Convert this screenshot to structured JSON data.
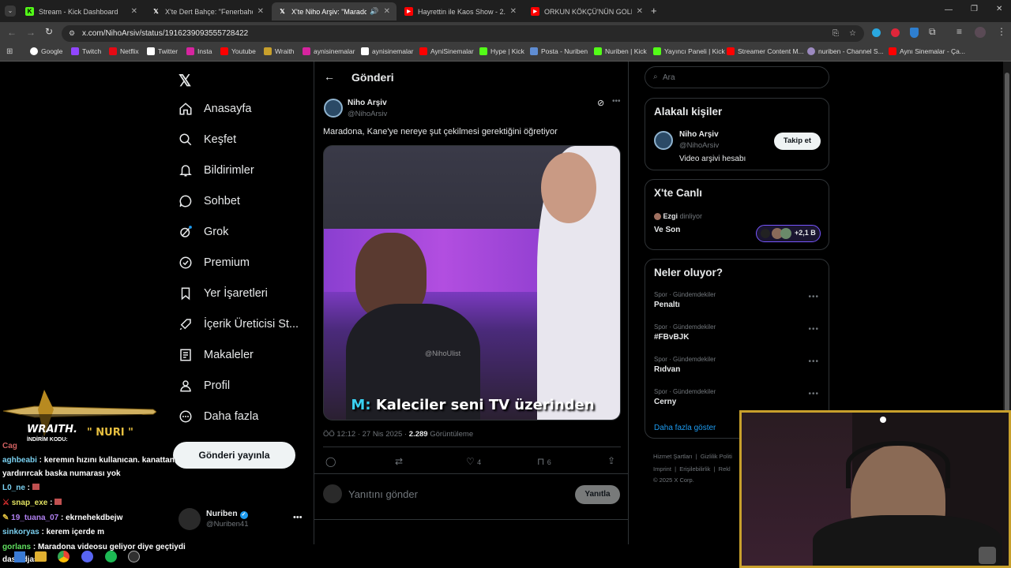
{
  "tabs": [
    {
      "label": "Stream - Kick Dashboard",
      "color": "#53fc18"
    },
    {
      "label": "X'te Dert Bahçe: \"Fenerbahçe'n",
      "color": "#ffffff"
    },
    {
      "label": "X'te Niho Arşiv: \"Maradona",
      "color": "#ffffff"
    },
    {
      "label": "Hayrettin ile Kaos Show - 2.Se",
      "color": "#ff0000"
    },
    {
      "label": "ORKUN KÖKÇÜ'NÜN GOLLERİ",
      "color": "#ff0000"
    }
  ],
  "url": "x.com/NihoArsiv/status/1916239093555728422",
  "bookmarks": [
    "Google",
    "Twitch",
    "Netflix",
    "Twitter",
    "Insta",
    "Youtube",
    "Wraith",
    "aynisinemalar",
    "aynisinemalar",
    "AyniSinemalar",
    "Hype | Kick",
    "Posta - Nuriben",
    "Nuriben | Kick",
    "Yayıncı Paneli | Kick",
    "Streamer Content M...",
    "nuriben - Channel S...",
    "Aynı Sinemalar - Ça..."
  ],
  "nav": {
    "items": [
      "Anasayfa",
      "Keşfet",
      "Bildirimler",
      "Sohbet",
      "Grok",
      "Premium",
      "Yer İşaretleri",
      "İçerik Üreticisi St...",
      "Makaleler",
      "Profil",
      "Daha fazla"
    ],
    "post_button": "Gönderi yayınla",
    "account_name": "Nuriben",
    "account_handle": "@Nuriben41"
  },
  "post": {
    "header": "Gönderi",
    "author": "Niho Arşiv",
    "handle": "@NihoArsiv",
    "text": "Maradona, Kane'ye nereye şut çekilmesi gerektiğini öğretiyor",
    "video_watermark": "@NihoUlist",
    "video_caption_prefix": "M:",
    "video_caption": "Kaleciler seni TV üzerinden",
    "time": "ÖÖ 12:12 · 27 Nis 2025 · ",
    "views": "2.289",
    "views_label": " Görüntüleme",
    "likes": "4",
    "bookmarks": "6",
    "reply_placeholder": "Yanıtını gönder",
    "reply_button": "Yanıtla"
  },
  "sidebar": {
    "search_placeholder": "Ara",
    "people_title": "Alakalı kişiler",
    "person_name": "Niho Arşiv",
    "person_handle": "@NihoArsiv",
    "person_bio": "Video arşivi hesabı",
    "follow_button": "Takip et",
    "live_title": "X'te Canlı",
    "live_host": "Ezgi",
    "live_status": " dinliyor",
    "live_space": "Ve Son",
    "live_count": "+2,1 B",
    "trends_title": "Neler oluyor?",
    "trends": [
      {
        "category": "Spor · Gündemdekiler",
        "name": "Penaltı"
      },
      {
        "category": "Spor · Gündemdekiler",
        "name": "#FBvBJK"
      },
      {
        "category": "Spor · Gündemdekiler",
        "name": "Rıdvan"
      },
      {
        "category": "Spor · Gündemdekiler",
        "name": "Cerny"
      }
    ],
    "show_more": "Daha fazla göster",
    "footer_1": "Hizmet Şartları  |  Gizlilik Politi",
    "footer_2": "Imprint  |  Erişilebilirlik  |  Rekl",
    "footer_3": "© 2025 X Corp."
  },
  "overlay": {
    "wraith_title": "WRAITH.",
    "wraith_code_label": "İNDİRİM KODU:",
    "wraith_code": "\" NURI \"",
    "chat_cut": "Cag",
    "chat": [
      {
        "user": "aghbeabi",
        "msg": " : keremın hızını kullanıcan. kanattan"
      },
      {
        "user": "",
        "msg": "yardırırcak baska numarası yok"
      },
      {
        "user": "L0_ne",
        "msg": " : "
      },
      {
        "user": "snap_exe",
        "msg": " : "
      },
      {
        "user": "19_tuana_07",
        "msg": " : ekrnehekdbejw"
      },
      {
        "user": "sinkoryas",
        "msg": " : kerem içerde m"
      },
      {
        "user": "gorlans",
        "msg": " : Maradona videosu geliyor diye geçtiydi"
      },
      {
        "user": "",
        "msg": "dasikdjas"
      }
    ]
  },
  "colors": {
    "accent": "#1d9bf0",
    "border": "#2f3336",
    "muted": "#71767b",
    "overlay_gold": "#c8a02c"
  }
}
